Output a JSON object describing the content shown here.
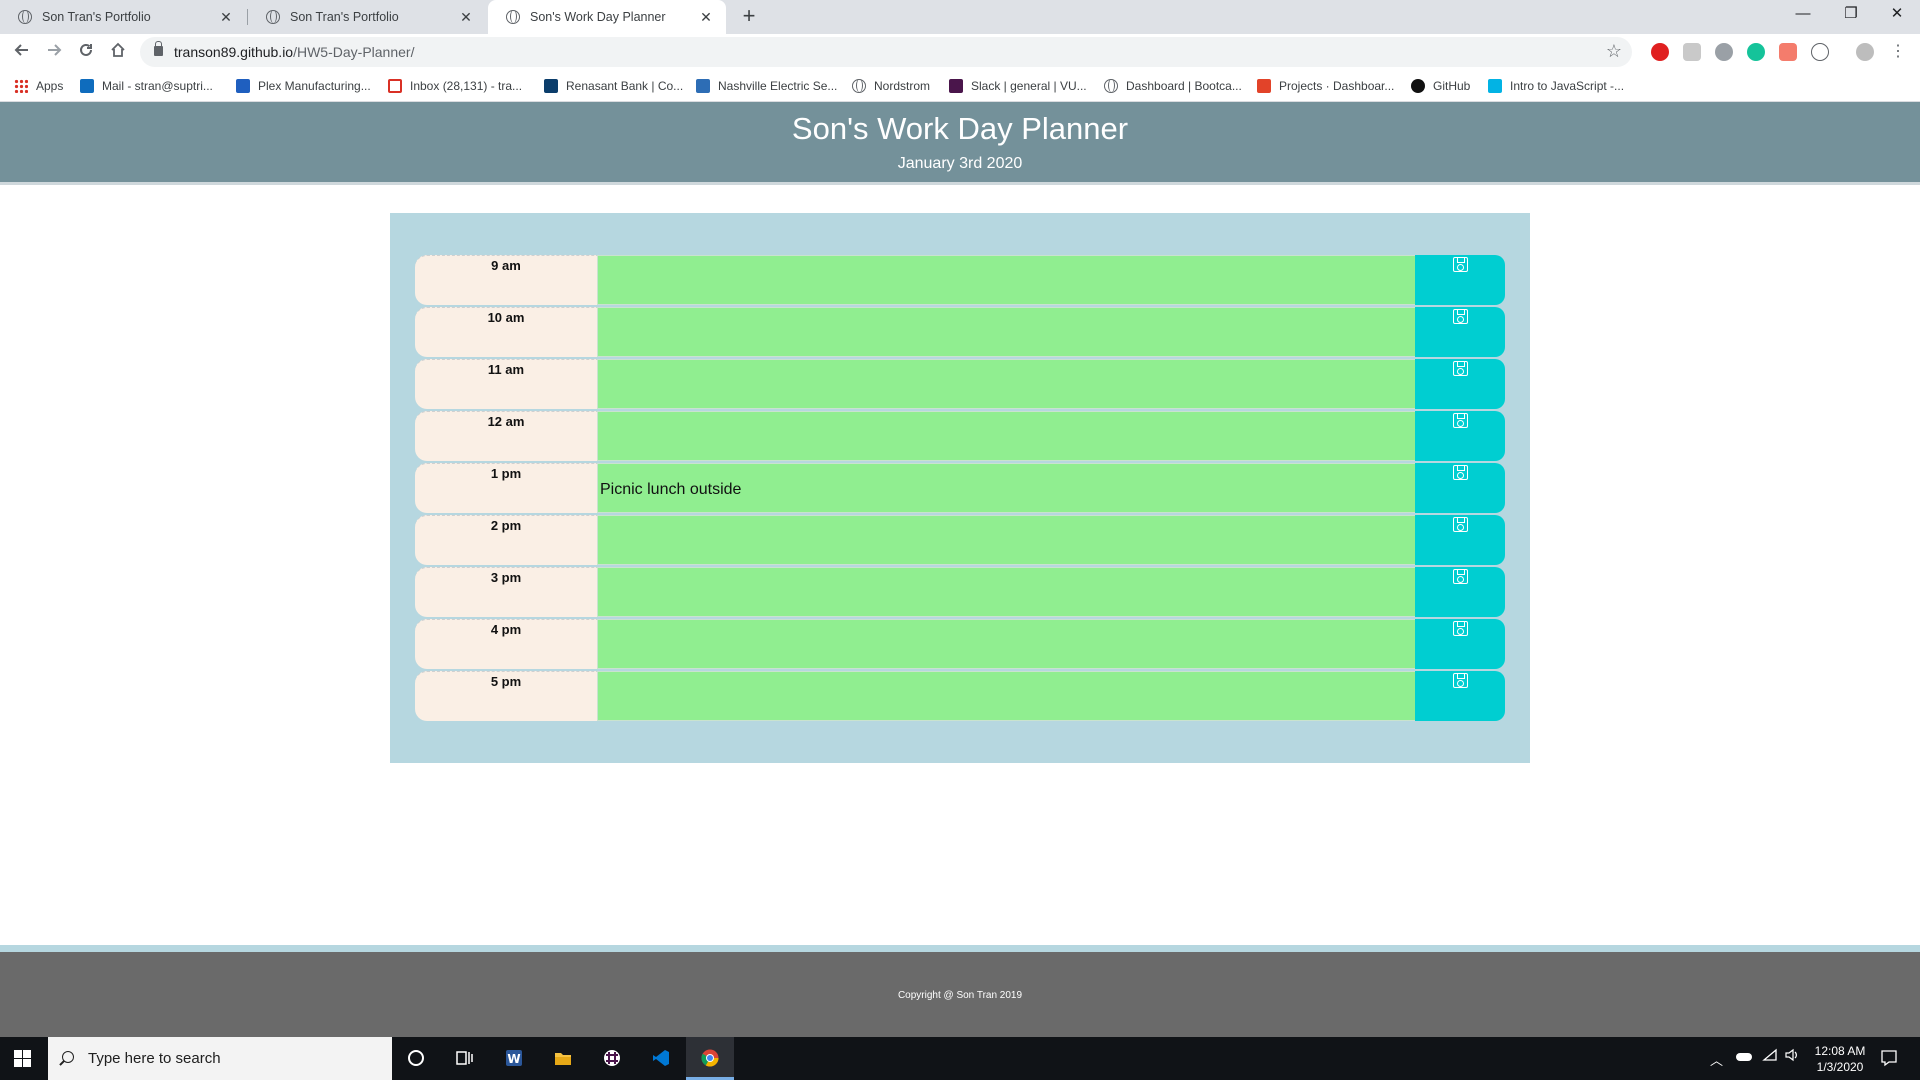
{
  "browser": {
    "tabs": [
      {
        "title": "Son Tran's Portfolio",
        "active": false
      },
      {
        "title": "Son Tran's Portfolio",
        "active": false
      },
      {
        "title": "Son's Work Day Planner",
        "active": true
      }
    ],
    "close_glyph": "✕",
    "new_tab_glyph": "+",
    "window_controls": {
      "minimize": "—",
      "maximize": "❐",
      "close": "✕"
    },
    "url_host": "transon89.github.io",
    "url_path": "/HW5-Day-Planner/",
    "bookmarks": [
      {
        "label": "Apps",
        "icon": "apps-grid-icon",
        "color": "#d93025"
      },
      {
        "label": "Mail - stran@suptri...",
        "icon": "outlook-icon",
        "color": "#0f6cbd"
      },
      {
        "label": "Plex Manufacturing...",
        "icon": "plex-icon",
        "color": "#1f5fbf"
      },
      {
        "label": "Inbox (28,131) - tra...",
        "icon": "gmail-icon",
        "color": "#d93025"
      },
      {
        "label": "Renasant Bank | Co...",
        "icon": "bank-icon",
        "color": "#0b3d6b"
      },
      {
        "label": "Nashville Electric Se...",
        "icon": "nes-icon",
        "color": "#2d6db5"
      },
      {
        "label": "Nordstrom",
        "icon": "globe-icon",
        "color": "#5f6368"
      },
      {
        "label": "Slack | general | VU...",
        "icon": "slack-icon",
        "color": "#4a154b"
      },
      {
        "label": "Dashboard | Bootca...",
        "icon": "globe-icon",
        "color": "#5f6368"
      },
      {
        "label": "Projects · Dashboar...",
        "icon": "gitlab-icon",
        "color": "#e24329"
      },
      {
        "label": "GitHub",
        "icon": "github-icon",
        "color": "#111111"
      },
      {
        "label": "Intro to JavaScript -...",
        "icon": "udacity-icon",
        "color": "#02b3e4"
      }
    ]
  },
  "header": {
    "title": "Son's Work Day Planner",
    "date": "January 3rd 2020"
  },
  "planner": {
    "rows": [
      {
        "hour": "9 am",
        "text": ""
      },
      {
        "hour": "10 am",
        "text": ""
      },
      {
        "hour": "11 am",
        "text": ""
      },
      {
        "hour": "12 am",
        "text": ""
      },
      {
        "hour": "1 pm",
        "text": "Picnic lunch outside"
      },
      {
        "hour": "2 pm",
        "text": ""
      },
      {
        "hour": "3 pm",
        "text": ""
      },
      {
        "hour": "4 pm",
        "text": ""
      },
      {
        "hour": "5 pm",
        "text": ""
      }
    ],
    "colors": {
      "future": "#90ee90",
      "save": "#00ced1",
      "hour": "#faefe5",
      "container": "#b6d7e0"
    }
  },
  "footer": {
    "copyright": "Copyright @ Son Tran 2019"
  },
  "taskbar": {
    "search_placeholder": "Type here to search",
    "time": "12:08 AM",
    "date": "1/3/2020"
  }
}
